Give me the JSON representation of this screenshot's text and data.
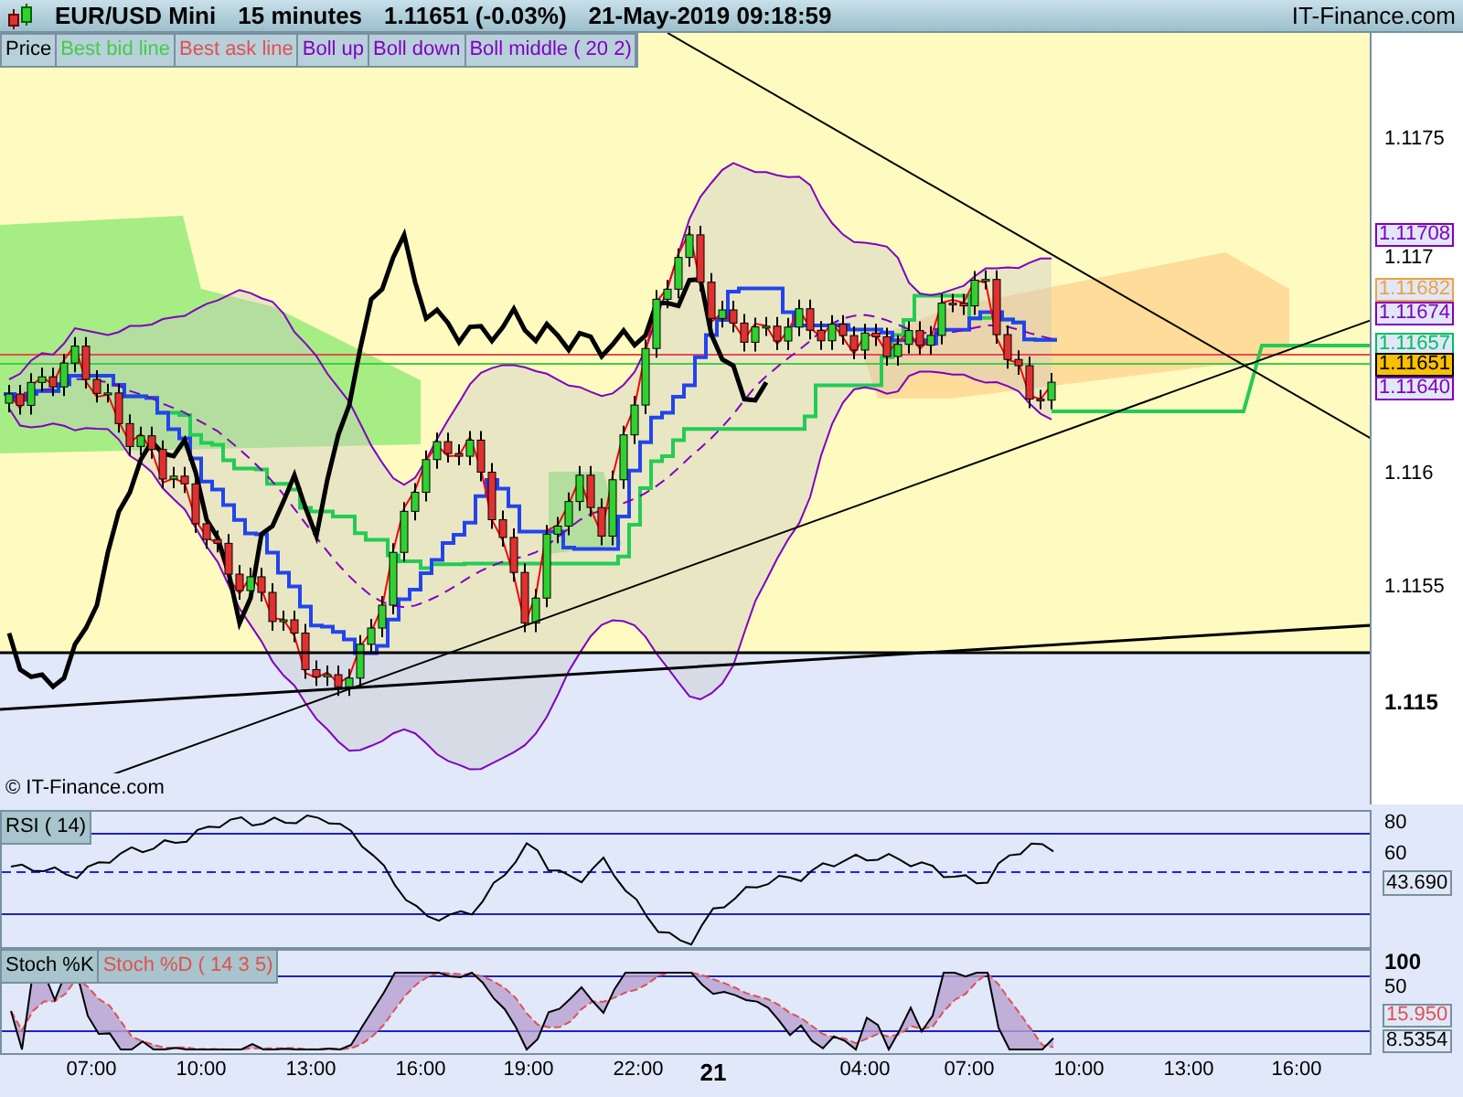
{
  "header": {
    "symbol": "EUR/USD Mini",
    "interval": "15 minutes",
    "price": "1.11651 (-0.03%)",
    "datetime": "21-May-2019 09:18:59",
    "brand": "IT-Finance.com"
  },
  "legend": [
    {
      "label": "Price",
      "color": "#000000"
    },
    {
      "label": "Best bid line",
      "color": "#44cc44"
    },
    {
      "label": "Best ask line",
      "color": "#e05050"
    },
    {
      "label": "Boll up",
      "color": "#8000c0"
    },
    {
      "label": "Boll down",
      "color": "#8000c0"
    },
    {
      "label": "Boll middle ( 20 2)",
      "color": "#8000c0"
    }
  ],
  "price_axis": {
    "ticks": [
      {
        "label": "1.1175",
        "kind": "normal"
      },
      {
        "label": "1.117",
        "kind": "normal"
      },
      {
        "label": "1.116",
        "kind": "normal"
      },
      {
        "label": "1.1155",
        "kind": "normal"
      },
      {
        "label": "1.115",
        "kind": "major"
      }
    ],
    "markers": [
      {
        "label": "1.11708",
        "color": "#8000c0",
        "kind": "box"
      },
      {
        "label": "1.11682",
        "color": "#f0a040",
        "kind": "box"
      },
      {
        "label": "1.11674",
        "color": "#8000c0",
        "kind": "box"
      },
      {
        "label": "1.11657",
        "color": "#00c060",
        "kind": "box"
      },
      {
        "label": "1.11651",
        "color": "#000000",
        "kind": "current"
      },
      {
        "label": "1.11640",
        "color": "#8000c0",
        "kind": "box"
      }
    ]
  },
  "copyright": "© IT-Finance.com",
  "rsi": {
    "legend": "RSI ( 14)",
    "ticks": [
      "80",
      "60"
    ],
    "value": "43.690"
  },
  "stoch": {
    "legend_k": "Stoch %K",
    "legend_d": "Stoch %D ( 14 3 5)",
    "ticks": [
      {
        "label": "100",
        "kind": "major"
      },
      {
        "label": "50",
        "kind": "normal"
      }
    ],
    "values": [
      {
        "label": "15.950",
        "color": "#e05050"
      },
      {
        "label": "8.5354",
        "color": "#000000"
      }
    ]
  },
  "time_axis": [
    {
      "label": "07:00",
      "kind": "time"
    },
    {
      "label": "10:00",
      "kind": "time"
    },
    {
      "label": "13:00",
      "kind": "time"
    },
    {
      "label": "16:00",
      "kind": "time"
    },
    {
      "label": "19:00",
      "kind": "time"
    },
    {
      "label": "22:00",
      "kind": "time"
    },
    {
      "label": "21",
      "kind": "day"
    },
    {
      "label": "04:00",
      "kind": "time"
    },
    {
      "label": "07:00",
      "kind": "time"
    },
    {
      "label": "10:00",
      "kind": "time"
    },
    {
      "label": "13:00",
      "kind": "time"
    },
    {
      "label": "16:00",
      "kind": "time"
    }
  ]
}
